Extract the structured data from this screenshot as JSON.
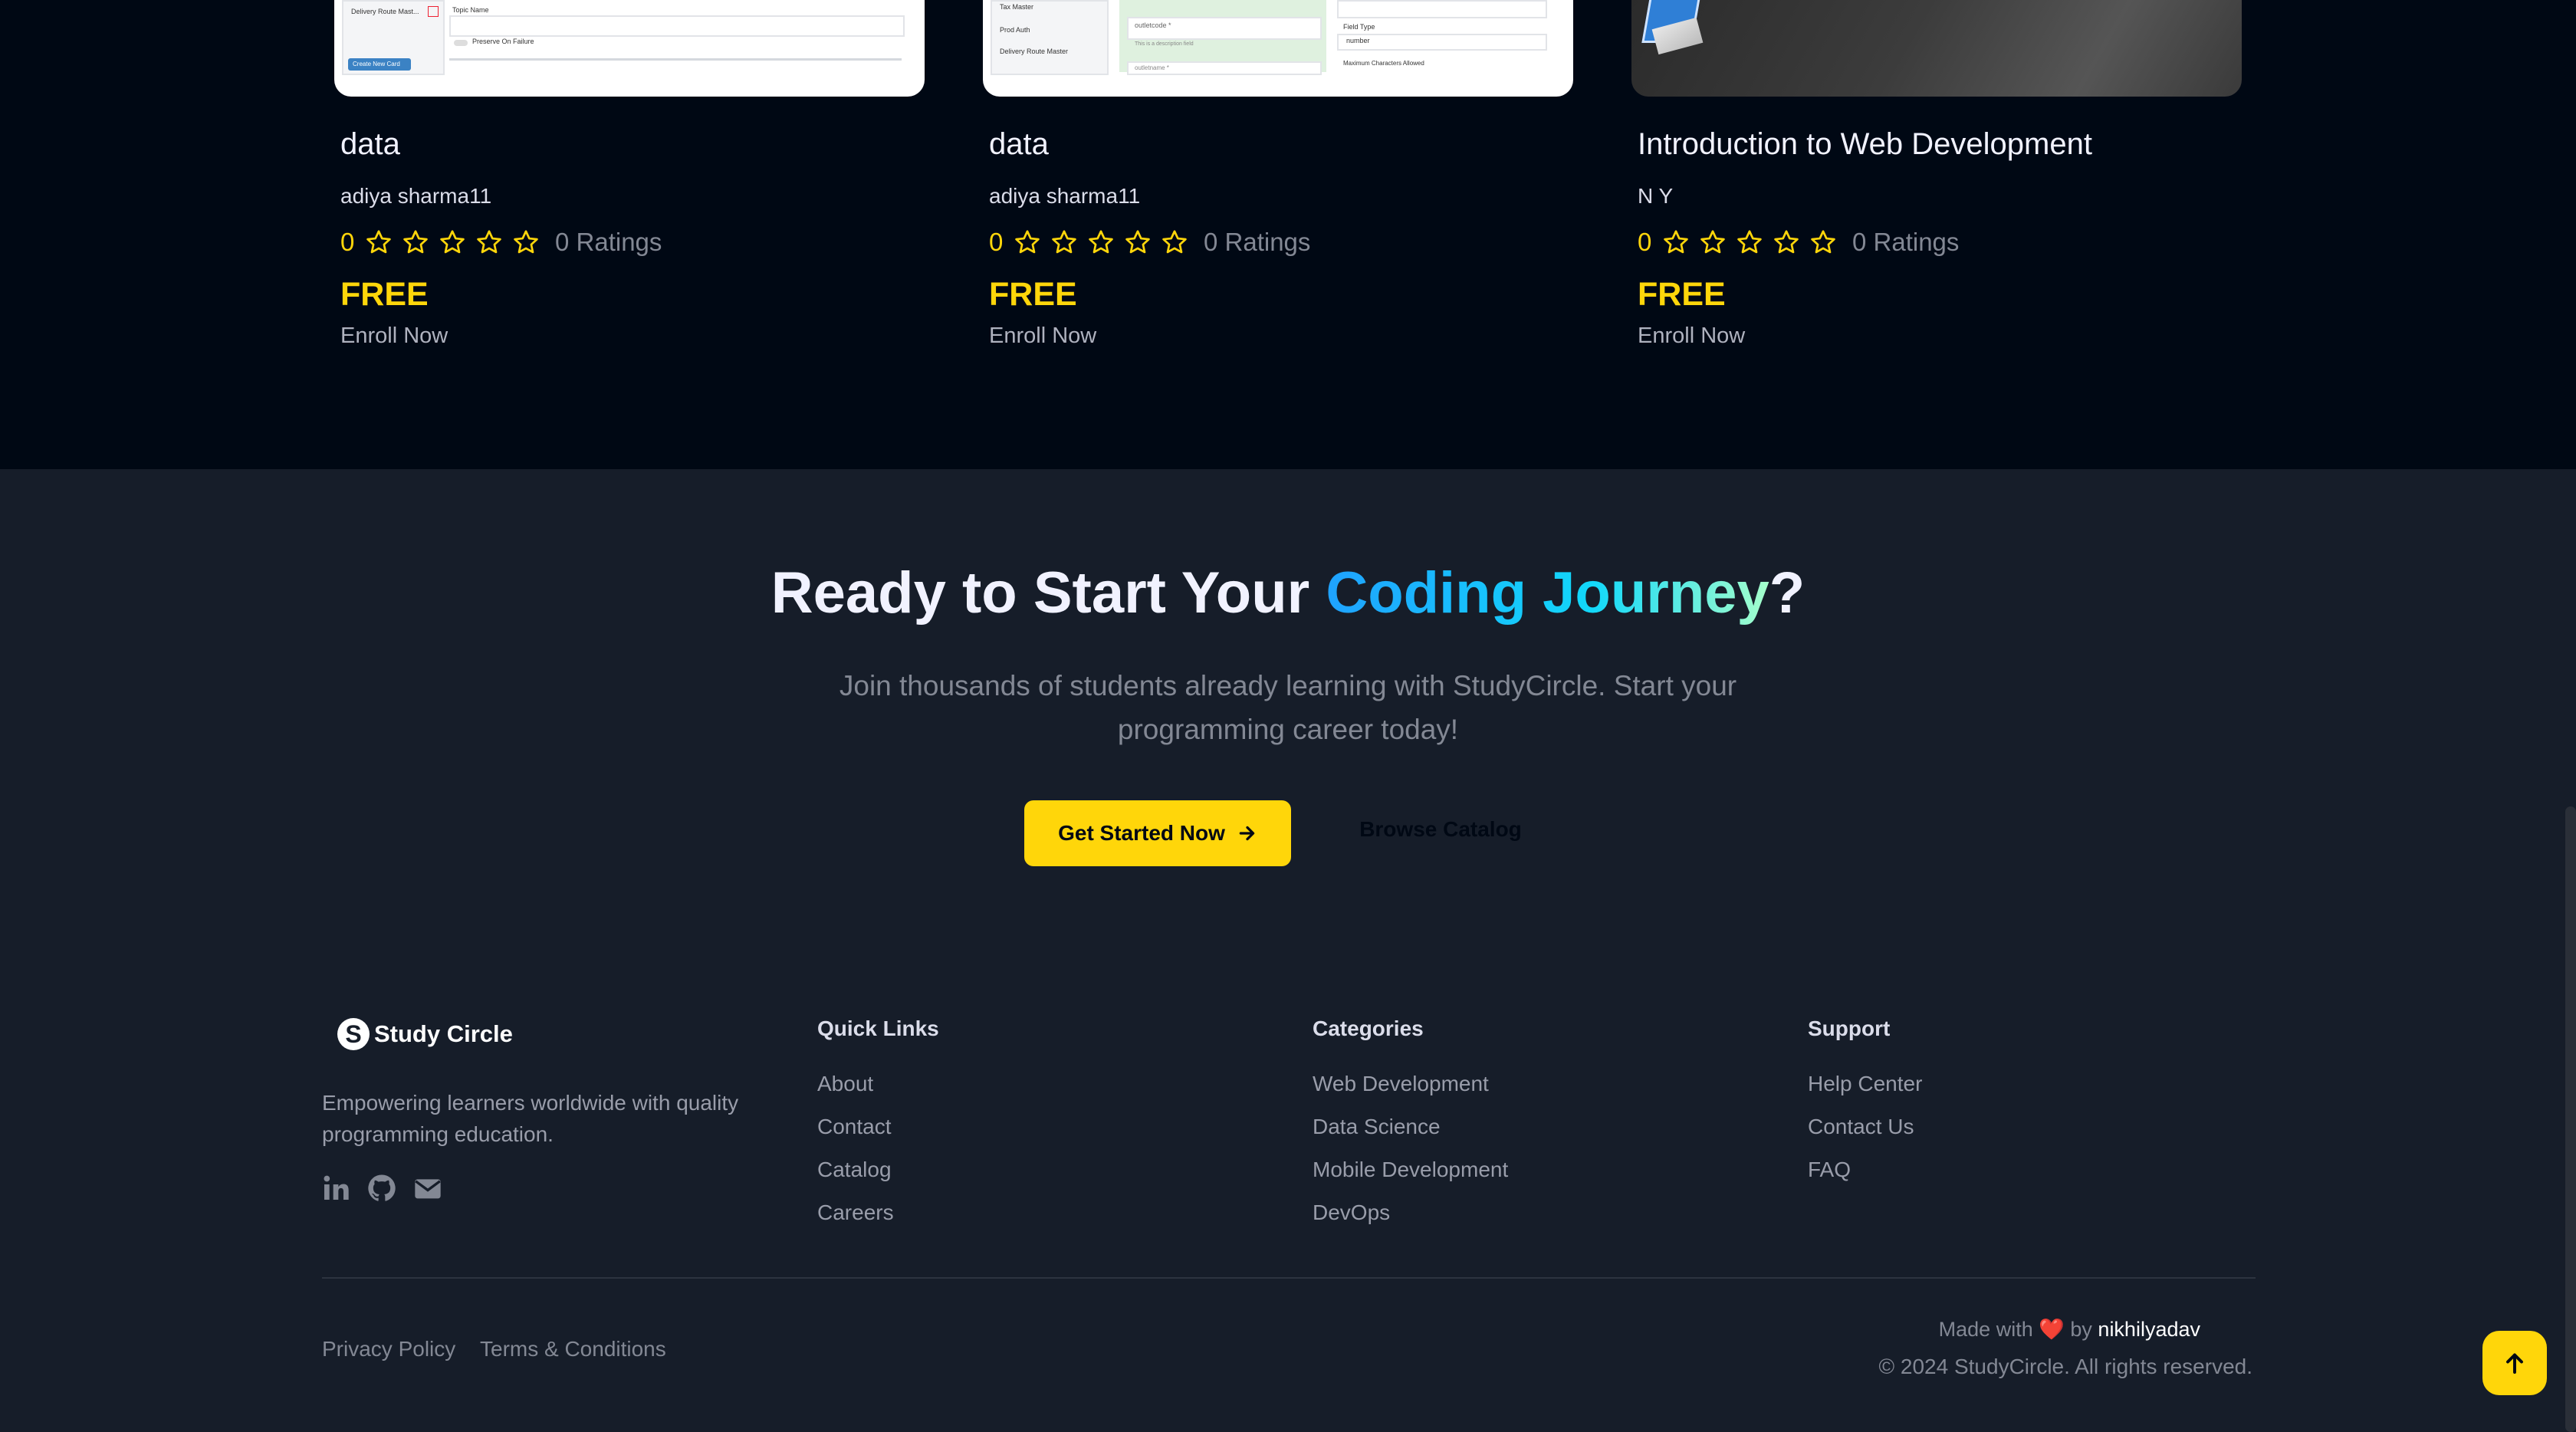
{
  "courses": [
    {
      "title": "data",
      "author": "adiya sharma11",
      "rating": "0",
      "rating_count": "0 Ratings",
      "stars": 5,
      "price": "FREE",
      "enroll": "Enroll Now"
    },
    {
      "title": "data",
      "author": "adiya sharma11",
      "rating": "0",
      "rating_count": "0 Ratings",
      "stars": 5,
      "price": "FREE",
      "enroll": "Enroll Now"
    },
    {
      "title": "Introduction to Web Development",
      "author": "N Y",
      "rating": "0",
      "rating_count": "0 Ratings",
      "stars": 5,
      "price": "FREE",
      "enroll": "Enroll Now"
    }
  ],
  "thumb_texts": {
    "c1": {
      "row1": "Delivery Route Mast...",
      "field": "Topic Name",
      "check": "Preserve On Failure",
      "btn": "Create New Card"
    },
    "c2": {
      "row1": "Tax Master",
      "row2": "Prod Auth",
      "row3": "Delivery Route Master",
      "f1": "outletcode *",
      "f2": "This is a description field",
      "f3": "outletname *",
      "type": "Field Type",
      "val": "number",
      "max": "Maximum Characters Allowed"
    }
  },
  "cta": {
    "title_prefix": "Ready to Start Your ",
    "title_highlight": "Coding Journey",
    "title_suffix": "?",
    "subtitle": "Join thousands of students already learning with StudyCircle. Start your programming career today!",
    "primary_button": "Get Started Now",
    "secondary_button": "Browse Catalog"
  },
  "footer": {
    "brand_mark": "S",
    "brand": "Study Circle",
    "tagline": "Empowering learners worldwide with quality programming education.",
    "social_icons": [
      "linkedin-icon",
      "github-icon",
      "mail-icon"
    ],
    "quick_links": {
      "heading": "Quick Links",
      "items": [
        "About",
        "Contact",
        "Catalog",
        "Careers"
      ]
    },
    "categories": {
      "heading": "Categories",
      "items": [
        "Web Development",
        "Data Science",
        "Mobile Development",
        "DevOps"
      ]
    },
    "support": {
      "heading": "Support",
      "items": [
        "Help Center",
        "Contact Us",
        "FAQ"
      ]
    },
    "legal": [
      "Privacy Policy",
      "Terms & Conditions"
    ],
    "made_with": "Made with",
    "heart": "❤️",
    "by": "by",
    "author": "nikhilyadav",
    "copyright": "© 2024 StudyCircle. All rights reserved."
  },
  "colors": {
    "accent": "#ffd60a",
    "bg_top": "#000814",
    "bg_bottom": "#161d29"
  }
}
